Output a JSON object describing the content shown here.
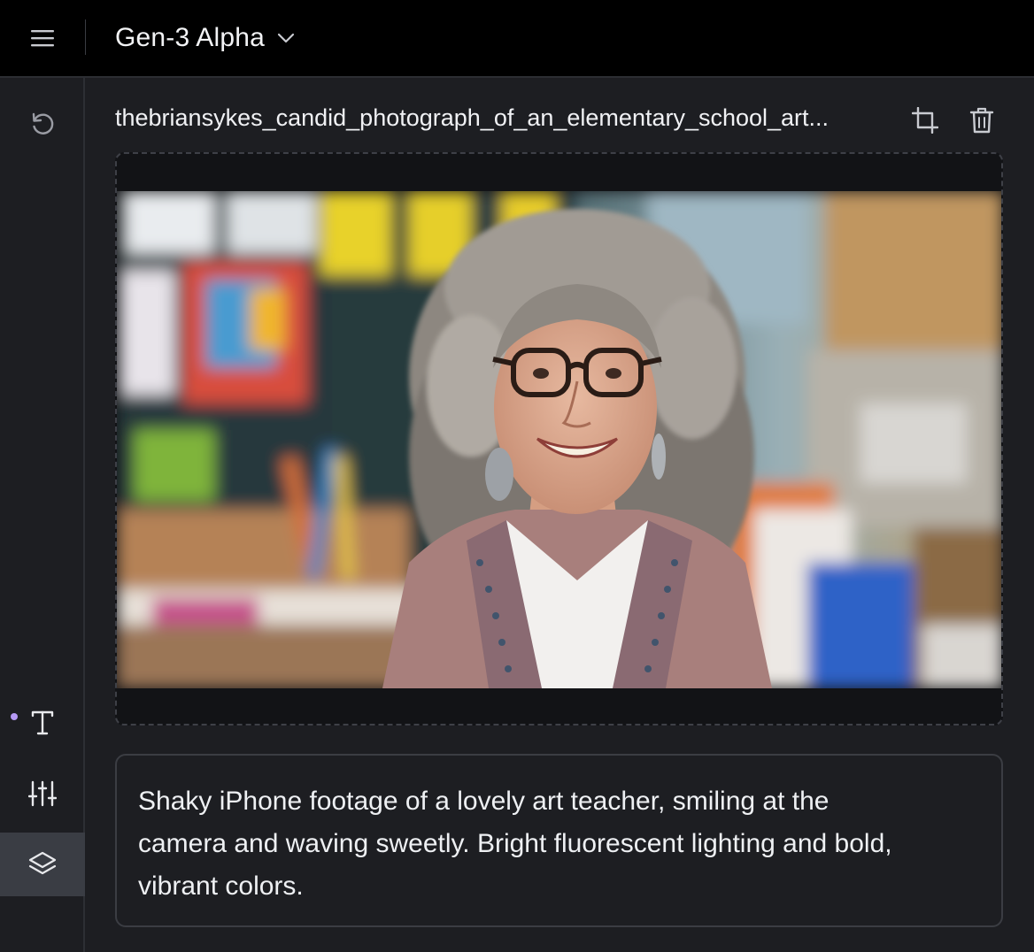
{
  "header": {
    "model_name": "Gen-3 Alpha",
    "menu_icon": "hamburger-menu-icon",
    "dropdown_icon": "chevron-down-icon"
  },
  "sidebar": {
    "items": [
      {
        "name": "reset",
        "icon": "undo-icon",
        "active": false
      },
      {
        "name": "text",
        "icon": "text-icon",
        "active": false,
        "indicator": true
      },
      {
        "name": "settings",
        "icon": "sliders-icon",
        "active": false
      },
      {
        "name": "layers",
        "icon": "layers-icon",
        "active": true
      }
    ]
  },
  "asset": {
    "file_name": "thebriansykes_candid_photograph_of_an_elementary_school_art...",
    "crop_icon": "crop-icon",
    "delete_icon": "trash-icon",
    "image_description": "Photo of a smiling woman with curly gray hair and glasses in a colorful classroom"
  },
  "prompt": {
    "text": "Shaky iPhone footage of a lovely art teacher, smiling at the camera and waving sweetly. Bright fluorescent lighting and bold, vibrant colors."
  },
  "colors": {
    "accent": "#b69af5",
    "background": "#1d1e22",
    "topbar": "#000000"
  }
}
